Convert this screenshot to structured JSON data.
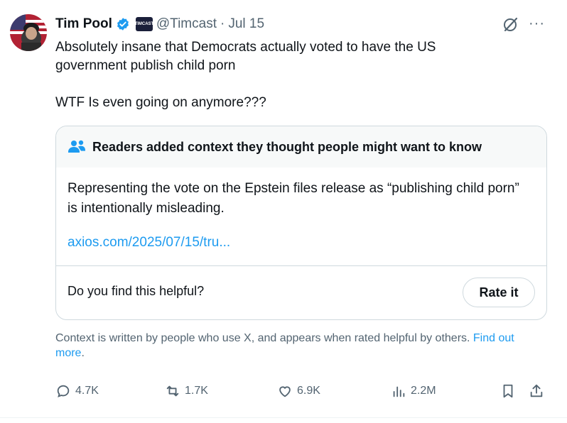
{
  "author": {
    "name": "Tim Pool",
    "handle": "@Timcast",
    "separator": "·",
    "date": "Jul 15",
    "affiliate_badge_text": "TIMCAST"
  },
  "tweet": {
    "line1": "Absolutely insane that Democrats actually voted to have the US government publish child porn",
    "line2": "WTF Is even going on anymore???"
  },
  "community_note": {
    "header": "Readers added context they thought people might want to know",
    "body": "Representing the vote on the Epstein files release as “publishing child porn” is intentionally misleading.",
    "link": "axios.com/2025/07/15/tru...",
    "helpful_question": "Do you find this helpful?",
    "rate_button": "Rate it"
  },
  "footnote": {
    "text": "Context is written by people who use X, and appears when rated helpful by others. ",
    "link": "Find out more",
    "end": "."
  },
  "actions": {
    "replies": "4.7K",
    "reposts": "1.7K",
    "likes": "6.9K",
    "views": "2.2M"
  },
  "colors": {
    "accent": "#1d9bf0",
    "muted": "#536471",
    "border": "#cfd9de",
    "verified": "#1d9bf0"
  },
  "icons": [
    "verified-badge-icon",
    "grok-icon",
    "more-icon",
    "people-icon",
    "reply-icon",
    "repost-icon",
    "like-icon",
    "views-icon",
    "bookmark-icon",
    "share-icon"
  ]
}
